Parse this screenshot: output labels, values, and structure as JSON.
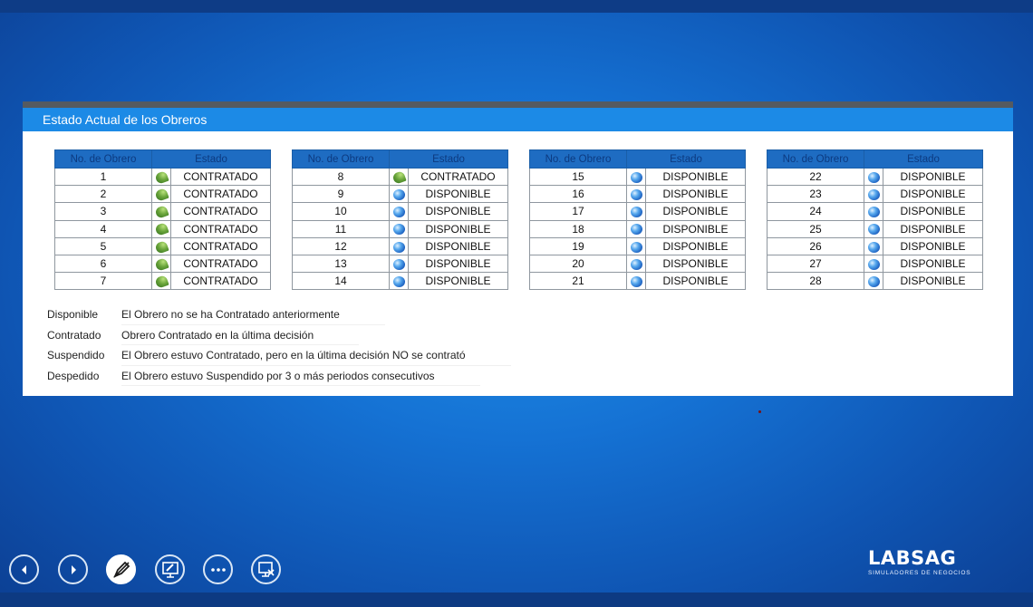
{
  "panel": {
    "title": "Estado Actual de los Obreros"
  },
  "columns": {
    "num": "No. de Obrero",
    "estado": "Estado"
  },
  "workers": [
    [
      {
        "num": "1",
        "estado": "CONTRATADO",
        "icon": "contracted-icon"
      },
      {
        "num": "2",
        "estado": "CONTRATADO",
        "icon": "contracted-icon"
      },
      {
        "num": "3",
        "estado": "CONTRATADO",
        "icon": "contracted-icon"
      },
      {
        "num": "4",
        "estado": "CONTRATADO",
        "icon": "contracted-icon"
      },
      {
        "num": "5",
        "estado": "CONTRATADO",
        "icon": "contracted-icon"
      },
      {
        "num": "6",
        "estado": "CONTRATADO",
        "icon": "contracted-icon"
      },
      {
        "num": "7",
        "estado": "CONTRATADO",
        "icon": "contracted-icon"
      }
    ],
    [
      {
        "num": "8",
        "estado": "CONTRATADO",
        "icon": "contracted-icon"
      },
      {
        "num": "9",
        "estado": "DISPONIBLE",
        "icon": "available-icon"
      },
      {
        "num": "10",
        "estado": "DISPONIBLE",
        "icon": "available-icon"
      },
      {
        "num": "11",
        "estado": "DISPONIBLE",
        "icon": "available-icon"
      },
      {
        "num": "12",
        "estado": "DISPONIBLE",
        "icon": "available-icon"
      },
      {
        "num": "13",
        "estado": "DISPONIBLE",
        "icon": "available-icon"
      },
      {
        "num": "14",
        "estado": "DISPONIBLE",
        "icon": "available-icon"
      }
    ],
    [
      {
        "num": "15",
        "estado": "DISPONIBLE",
        "icon": "available-icon"
      },
      {
        "num": "16",
        "estado": "DISPONIBLE",
        "icon": "available-icon"
      },
      {
        "num": "17",
        "estado": "DISPONIBLE",
        "icon": "available-icon"
      },
      {
        "num": "18",
        "estado": "DISPONIBLE",
        "icon": "available-icon"
      },
      {
        "num": "19",
        "estado": "DISPONIBLE",
        "icon": "available-icon"
      },
      {
        "num": "20",
        "estado": "DISPONIBLE",
        "icon": "available-icon"
      },
      {
        "num": "21",
        "estado": "DISPONIBLE",
        "icon": "available-icon"
      }
    ],
    [
      {
        "num": "22",
        "estado": "DISPONIBLE",
        "icon": "available-icon"
      },
      {
        "num": "23",
        "estado": "DISPONIBLE",
        "icon": "available-icon"
      },
      {
        "num": "24",
        "estado": "DISPONIBLE",
        "icon": "available-icon"
      },
      {
        "num": "25",
        "estado": "DISPONIBLE",
        "icon": "available-icon"
      },
      {
        "num": "26",
        "estado": "DISPONIBLE",
        "icon": "available-icon"
      },
      {
        "num": "27",
        "estado": "DISPONIBLE",
        "icon": "available-icon"
      },
      {
        "num": "28",
        "estado": "DISPONIBLE",
        "icon": "available-icon"
      }
    ]
  ],
  "legend": [
    {
      "term": "Disponible",
      "desc": "El Obrero no se ha Contratado anteriormente"
    },
    {
      "term": "Contratado",
      "desc": "Obrero Contratado en la última decisión"
    },
    {
      "term": "Suspendido",
      "desc": "El Obrero estuvo Contratado, pero en la última decisión NO se contrató"
    },
    {
      "term": "Despedido",
      "desc": "El Obrero estuvo Suspendido por 3 o más periodos consecutivos"
    }
  ],
  "nav": [
    {
      "name": "previous-slide-button",
      "icon": "chevron-left-icon"
    },
    {
      "name": "next-slide-button",
      "icon": "chevron-right-icon"
    },
    {
      "name": "pen-tool-button",
      "icon": "pen-icon"
    },
    {
      "name": "screen-pointer-button",
      "icon": "pointer-screen-icon"
    },
    {
      "name": "more-options-button",
      "icon": "ellipsis-icon"
    },
    {
      "name": "end-slideshow-button",
      "icon": "close-screen-icon"
    }
  ],
  "logo": {
    "brand": "LABSAG",
    "tagline": "SIMULADORES DE NEGOCIOS"
  },
  "colors": {
    "panel_header": "#1c8ae6",
    "table_header": "#1e6cc2",
    "background": "#1572d4"
  }
}
